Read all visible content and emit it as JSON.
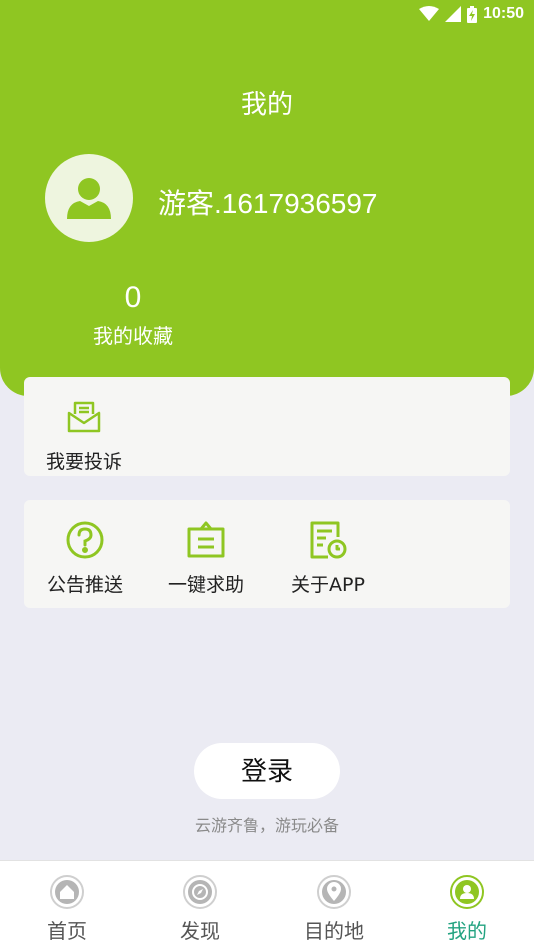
{
  "status": {
    "time": "10:50"
  },
  "header": {
    "title": "我的"
  },
  "profile": {
    "username": "游客.1617936597"
  },
  "favorites": {
    "count": "0",
    "label": "我的收藏"
  },
  "card1": {
    "items": [
      {
        "label": "我要投诉",
        "icon": "envelope-icon"
      }
    ]
  },
  "card2": {
    "items": [
      {
        "label": "公告推送",
        "icon": "question-circle-icon"
      },
      {
        "label": "一键求助",
        "icon": "help-sign-icon"
      },
      {
        "label": "关于APP",
        "icon": "document-clock-icon"
      }
    ]
  },
  "login": {
    "label": "登录"
  },
  "slogan": "云游齐鲁，游玩必备",
  "tabs": [
    {
      "label": "首页",
      "icon": "home-icon"
    },
    {
      "label": "发现",
      "icon": "compass-icon"
    },
    {
      "label": "目的地",
      "icon": "location-pin-icon"
    },
    {
      "label": "我的",
      "icon": "user-icon",
      "active": true
    }
  ],
  "colors": {
    "brand": "#8fc622",
    "active_tab": "#23a381",
    "background": "#ebebf3"
  }
}
